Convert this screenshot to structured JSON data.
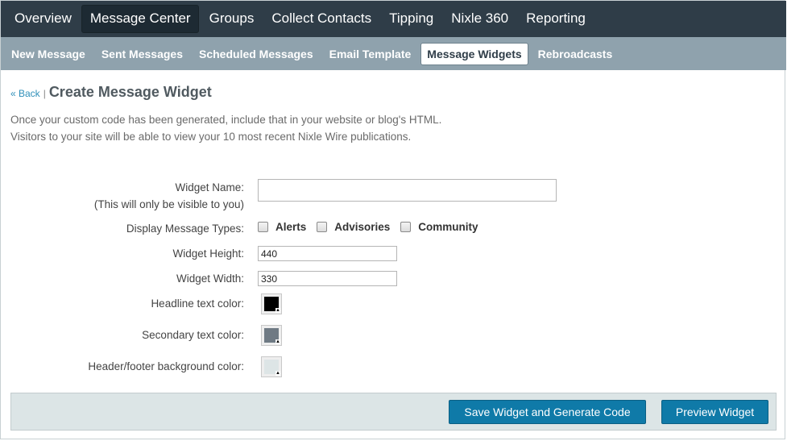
{
  "top_nav": {
    "items": [
      {
        "label": "Overview"
      },
      {
        "label": "Message Center",
        "active": true
      },
      {
        "label": "Groups"
      },
      {
        "label": "Collect Contacts"
      },
      {
        "label": "Tipping"
      },
      {
        "label": "Nixle 360"
      },
      {
        "label": "Reporting"
      }
    ]
  },
  "sub_nav": {
    "items": [
      {
        "label": "New Message"
      },
      {
        "label": "Sent Messages"
      },
      {
        "label": "Scheduled Messages"
      },
      {
        "label": "Email Template"
      },
      {
        "label": "Message Widgets",
        "active": true
      },
      {
        "label": "Rebroadcasts"
      }
    ]
  },
  "header": {
    "back_label": "« Back",
    "separator": "|",
    "title": "Create Message Widget"
  },
  "intro": {
    "line1": "Once your custom code has been generated, include that in your website or blog's HTML.",
    "line2": "Visitors to your site will be able to view your 10 most recent Nixle Wire publications."
  },
  "form": {
    "widget_name_label": "Widget Name:",
    "widget_name_note": "(This will only be visible to you)",
    "widget_name_value": "",
    "message_types_label": "Display Message Types:",
    "message_types": [
      {
        "label": "Alerts",
        "checked": false
      },
      {
        "label": "Advisories",
        "checked": false
      },
      {
        "label": "Community",
        "checked": false
      }
    ],
    "height_label": "Widget Height:",
    "height_value": "440",
    "width_label": "Widget Width:",
    "width_value": "330",
    "headline_color_label": "Headline text color:",
    "headline_color": "#000000",
    "secondary_color_label": "Secondary text color:",
    "secondary_color": "#6f7a84",
    "header_footer_color_label": "Header/footer background color:",
    "header_footer_color": "#dde5e6"
  },
  "actions": {
    "save_label": "Save Widget and Generate Code",
    "preview_label": "Preview Widget"
  },
  "colors": {
    "top_nav_bg": "#2f3d48",
    "sub_nav_bg": "#8fa2ad",
    "button_bg": "#0f7aa8",
    "link": "#2f8fb9"
  }
}
